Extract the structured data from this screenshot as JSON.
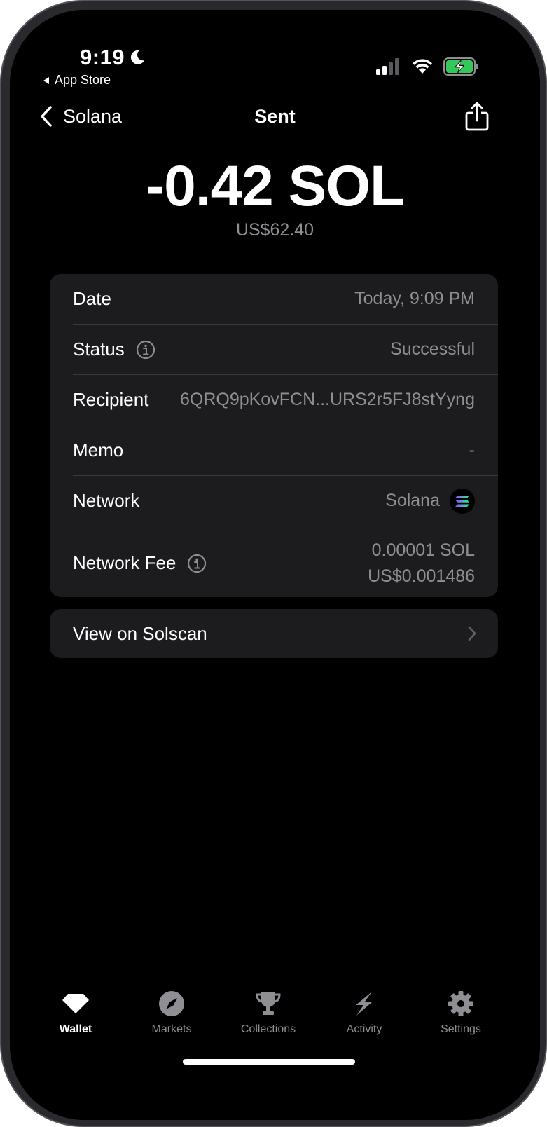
{
  "status_bar": {
    "time": "9:19",
    "back_app": "App Store"
  },
  "nav": {
    "back_label": "Solana",
    "title": "Sent"
  },
  "transaction": {
    "amount": "-0.42 SOL",
    "amount_usd": "US$62.40"
  },
  "details": {
    "date_label": "Date",
    "date_value": "Today, 9:09 PM",
    "status_label": "Status",
    "status_value": "Successful",
    "recipient_label": "Recipient",
    "recipient_value": "6QRQ9pKovFCN...URS2r5FJ8stYyng",
    "memo_label": "Memo",
    "memo_value": "-",
    "network_label": "Network",
    "network_value": "Solana",
    "fee_label": "Network Fee",
    "fee_sol": "0.00001 SOL",
    "fee_usd": "US$0.001486"
  },
  "solscan": {
    "label": "View on Solscan"
  },
  "tabs": [
    {
      "label": "Wallet",
      "icon": "gem-icon",
      "active": true
    },
    {
      "label": "Markets",
      "icon": "compass-icon",
      "active": false
    },
    {
      "label": "Collections",
      "icon": "trophy-icon",
      "active": false
    },
    {
      "label": "Activity",
      "icon": "lightning-icon",
      "active": false
    },
    {
      "label": "Settings",
      "icon": "gear-icon",
      "active": false
    }
  ],
  "colors": {
    "background": "#000000",
    "card": "#1c1c1e",
    "secondary_text": "#8e8e93",
    "battery_green": "#34c759"
  }
}
